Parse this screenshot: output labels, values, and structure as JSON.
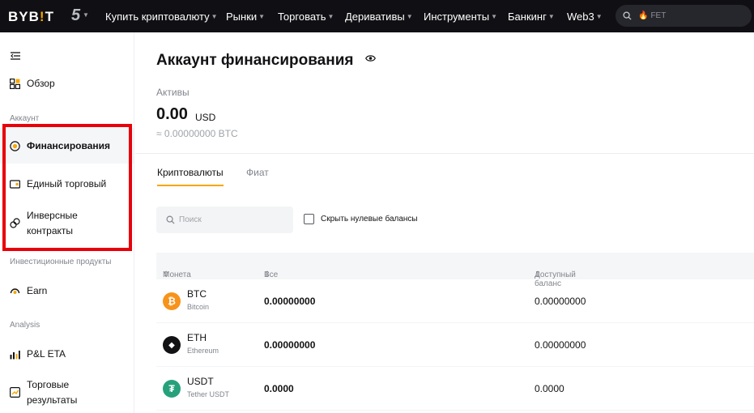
{
  "topbar": {
    "logo": "BYB",
    "logo_bar": "!",
    "logo_end": "T",
    "five": "5",
    "nav": [
      {
        "label": "Купить криптовалюту",
        "caret": true
      },
      {
        "label": "Рынки",
        "caret": true
      },
      {
        "label": "Торговать",
        "caret": true
      },
      {
        "label": "Деривативы",
        "caret": true
      },
      {
        "label": "Инструменты",
        "caret": true
      },
      {
        "label": "Банкинг",
        "caret": true
      },
      {
        "label": "Web3",
        "caret": true
      }
    ],
    "search_text": "FET"
  },
  "sidebar": {
    "overview": "Обзор",
    "section_account": "Аккаунт",
    "funding": "Финансирования",
    "unified": "Единый торговый",
    "inverse_line1": "Инверсные",
    "inverse_line2": "контракты",
    "section_invest": "Инвестиционные продукты",
    "earn": "Earn",
    "section_analysis": "Analysis",
    "pnl": "P&L ETA",
    "trade_results_line1": "Торговые",
    "trade_results_line2": "результаты"
  },
  "main": {
    "title": "Аккаунт финансирования",
    "assets_label": "Активы",
    "assets_value": "0.00",
    "assets_unit": "USD",
    "assets_btc": "≈ 0.00000000 BTC",
    "tab_crypto": "Криптовалюты",
    "tab_fiat": "Фиат",
    "search_placeholder": "Поиск",
    "hide_zero_label": "Скрыть нулевые балансы",
    "columns": {
      "coin": "Монета",
      "all": "Все",
      "available": "Доступный баланс"
    },
    "rows": [
      {
        "symbol": "BTC",
        "name": "Bitcoin",
        "total": "0.00000000",
        "available": "0.00000000",
        "color": "#f7931a",
        "glyph": "₿"
      },
      {
        "symbol": "ETH",
        "name": "Ethereum",
        "total": "0.00000000",
        "available": "0.00000000",
        "color": "#121214",
        "glyph": "◆"
      },
      {
        "symbol": "USDT",
        "name": "Tether USDT",
        "total": "0.0000",
        "available": "0.0000",
        "color": "#26a17b",
        "glyph": "₮"
      }
    ]
  },
  "colors": {
    "accent": "#f7a600",
    "highlight_box": "#e8000b",
    "topbar_bg": "#101014"
  }
}
